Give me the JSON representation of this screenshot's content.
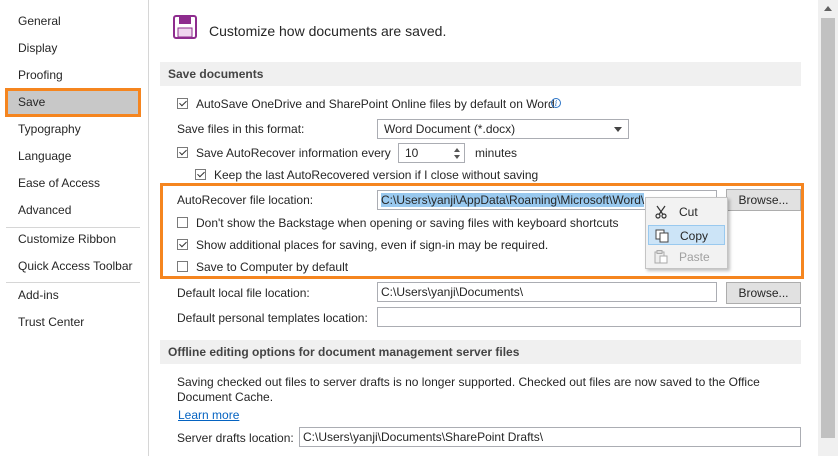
{
  "sidebar": {
    "items": [
      {
        "label": "General"
      },
      {
        "label": "Display"
      },
      {
        "label": "Proofing"
      },
      {
        "label": "Save"
      },
      {
        "label": "Typography"
      },
      {
        "label": "Language"
      },
      {
        "label": "Ease of Access"
      },
      {
        "label": "Advanced"
      },
      {
        "label": "Customize Ribbon"
      },
      {
        "label": "Quick Access Toolbar"
      },
      {
        "label": "Add-ins"
      },
      {
        "label": "Trust Center"
      }
    ],
    "selected": "Save"
  },
  "header": {
    "title": "Customize how documents are saved.",
    "icon": "save-floppy-icon"
  },
  "save_documents": {
    "section_title": "Save documents",
    "autosave_label": "AutoSave OneDrive and SharePoint Online files by default on Word",
    "autosave_checked": true,
    "format_label": "Save files in this format:",
    "format_value": "Word Document (*.docx)",
    "autorecover_label": "Save AutoRecover information every",
    "autorecover_checked": true,
    "autorecover_minutes": "10",
    "minutes_label": "minutes",
    "keep_last_label": "Keep the last AutoRecovered version if I close without saving",
    "keep_last_checked": true,
    "autorecover_location_label": "AutoRecover file location:",
    "autorecover_location_value": "C:\\Users\\yanji\\AppData\\Roaming\\Microsoft\\Word\\",
    "browse_label": "Browse...",
    "backstage_label": "Don't show the Backstage when opening or saving files with keyboard shortcuts",
    "backstage_checked": false,
    "additional_places_label": "Show additional places for saving, even if sign-in may be required.",
    "additional_places_checked": true,
    "save_to_computer_label": "Save to Computer by default",
    "save_to_computer_checked": false,
    "default_local_label": "Default local file location:",
    "default_local_value": "C:\\Users\\yanji\\Documents\\",
    "browse2_label": "Browse...",
    "personal_templates_label": "Default personal templates location:",
    "personal_templates_value": ""
  },
  "offline": {
    "section_title": "Offline editing options for document management server files",
    "notice": "Saving checked out files to server drafts is no longer supported. Checked out files are now saved to the Office Document Cache.",
    "learn_more": "Learn more",
    "server_drafts_label": "Server drafts location:",
    "server_drafts_value": "C:\\Users\\yanji\\Documents\\SharePoint Drafts\\"
  },
  "context_menu": {
    "items": [
      {
        "label": "Cut",
        "icon": "scissors-icon",
        "state": "normal"
      },
      {
        "label": "Copy",
        "icon": "copy-icon",
        "state": "hover"
      },
      {
        "label": "Paste",
        "icon": "paste-icon",
        "state": "disabled"
      }
    ]
  },
  "colors": {
    "highlight": "#f5851f",
    "selected_nav": "#c8c8c8",
    "selection": "#99c9ef",
    "link": "#0563c1"
  }
}
